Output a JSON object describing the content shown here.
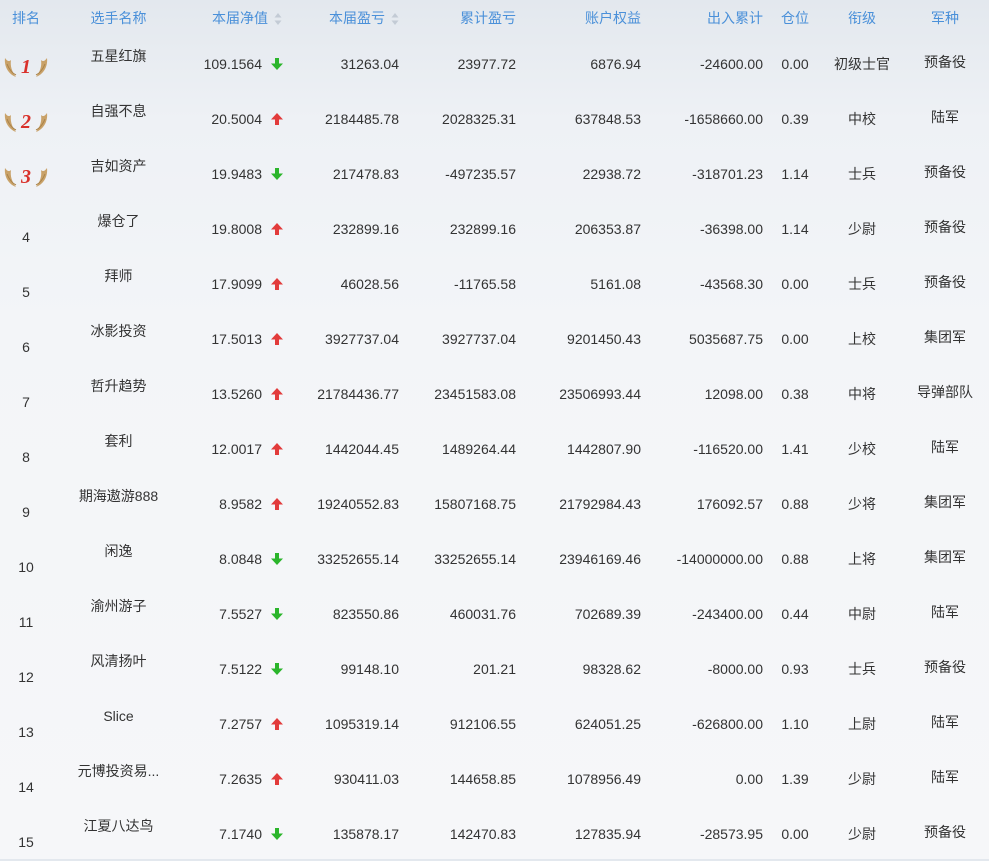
{
  "headers": {
    "rank": "排名",
    "name": "选手名称",
    "net_value": "本届净值",
    "profit": "本届盈亏",
    "cum_profit": "累计盈亏",
    "equity": "账户权益",
    "flow": "出入累计",
    "position": "仓位",
    "military_rank": "衔级",
    "arm": "军种"
  },
  "colors": {
    "header_text": "#4a90d9",
    "up": "#e23b3b",
    "down": "#2bb52b",
    "medal": "#c9a269",
    "medal_num": "#d9312b"
  },
  "rows": [
    {
      "rank": "1",
      "medal": true,
      "name": "五星红旗",
      "net": "109.1564",
      "trend": "down",
      "profit": "31263.04",
      "cum": "23977.72",
      "equity": "6876.94",
      "flow": "-24600.00",
      "pos": "0.00",
      "mrank": "初级士官",
      "arm": "预备役"
    },
    {
      "rank": "2",
      "medal": true,
      "name": "自强不息",
      "net": "20.5004",
      "trend": "up",
      "profit": "2184485.78",
      "cum": "2028325.31",
      "equity": "637848.53",
      "flow": "-1658660.00",
      "pos": "0.39",
      "mrank": "中校",
      "arm": "陆军"
    },
    {
      "rank": "3",
      "medal": true,
      "name": "吉如资产",
      "net": "19.9483",
      "trend": "down",
      "profit": "217478.83",
      "cum": "-497235.57",
      "equity": "22938.72",
      "flow": "-318701.23",
      "pos": "1.14",
      "mrank": "士兵",
      "arm": "预备役"
    },
    {
      "rank": "4",
      "medal": false,
      "name": "爆仓了",
      "net": "19.8008",
      "trend": "up",
      "profit": "232899.16",
      "cum": "232899.16",
      "equity": "206353.87",
      "flow": "-36398.00",
      "pos": "1.14",
      "mrank": "少尉",
      "arm": "预备役"
    },
    {
      "rank": "5",
      "medal": false,
      "name": "拜师",
      "net": "17.9099",
      "trend": "up",
      "profit": "46028.56",
      "cum": "-11765.58",
      "equity": "5161.08",
      "flow": "-43568.30",
      "pos": "0.00",
      "mrank": "士兵",
      "arm": "预备役"
    },
    {
      "rank": "6",
      "medal": false,
      "name": "冰影投资",
      "net": "17.5013",
      "trend": "up",
      "profit": "3927737.04",
      "cum": "3927737.04",
      "equity": "9201450.43",
      "flow": "5035687.75",
      "pos": "0.00",
      "mrank": "上校",
      "arm": "集团军"
    },
    {
      "rank": "7",
      "medal": false,
      "name": "哲升趋势",
      "net": "13.5260",
      "trend": "up",
      "profit": "21784436.77",
      "cum": "23451583.08",
      "equity": "23506993.44",
      "flow": "12098.00",
      "pos": "0.38",
      "mrank": "中将",
      "arm": "导弹部队"
    },
    {
      "rank": "8",
      "medal": false,
      "name": "套利",
      "net": "12.0017",
      "trend": "up",
      "profit": "1442044.45",
      "cum": "1489264.44",
      "equity": "1442807.90",
      "flow": "-116520.00",
      "pos": "1.41",
      "mrank": "少校",
      "arm": "陆军"
    },
    {
      "rank": "9",
      "medal": false,
      "name": "期海遨游888",
      "net": "8.9582",
      "trend": "up",
      "profit": "19240552.83",
      "cum": "15807168.75",
      "equity": "21792984.43",
      "flow": "176092.57",
      "pos": "0.88",
      "mrank": "少将",
      "arm": "集团军"
    },
    {
      "rank": "10",
      "medal": false,
      "name": "闲逸",
      "net": "8.0848",
      "trend": "down",
      "profit": "33252655.14",
      "cum": "33252655.14",
      "equity": "23946169.46",
      "flow": "-14000000.00",
      "pos": "0.88",
      "mrank": "上将",
      "arm": "集团军"
    },
    {
      "rank": "11",
      "medal": false,
      "name": "渝州游子",
      "net": "7.5527",
      "trend": "down",
      "profit": "823550.86",
      "cum": "460031.76",
      "equity": "702689.39",
      "flow": "-243400.00",
      "pos": "0.44",
      "mrank": "中尉",
      "arm": "陆军"
    },
    {
      "rank": "12",
      "medal": false,
      "name": "风清扬叶",
      "net": "7.5122",
      "trend": "down",
      "profit": "99148.10",
      "cum": "201.21",
      "equity": "98328.62",
      "flow": "-8000.00",
      "pos": "0.93",
      "mrank": "士兵",
      "arm": "预备役"
    },
    {
      "rank": "13",
      "medal": false,
      "name": "Slice",
      "net": "7.2757",
      "trend": "up",
      "profit": "1095319.14",
      "cum": "912106.55",
      "equity": "624051.25",
      "flow": "-626800.00",
      "pos": "1.10",
      "mrank": "上尉",
      "arm": "陆军"
    },
    {
      "rank": "14",
      "medal": false,
      "name": "元博投资易...",
      "net": "7.2635",
      "trend": "up",
      "profit": "930411.03",
      "cum": "144658.85",
      "equity": "1078956.49",
      "flow": "0.00",
      "pos": "1.39",
      "mrank": "少尉",
      "arm": "陆军"
    },
    {
      "rank": "15",
      "medal": false,
      "name": "江夏八达鸟",
      "net": "7.1740",
      "trend": "down",
      "profit": "135878.17",
      "cum": "142470.83",
      "equity": "127835.94",
      "flow": "-28573.95",
      "pos": "0.00",
      "mrank": "少尉",
      "arm": "预备役"
    }
  ]
}
